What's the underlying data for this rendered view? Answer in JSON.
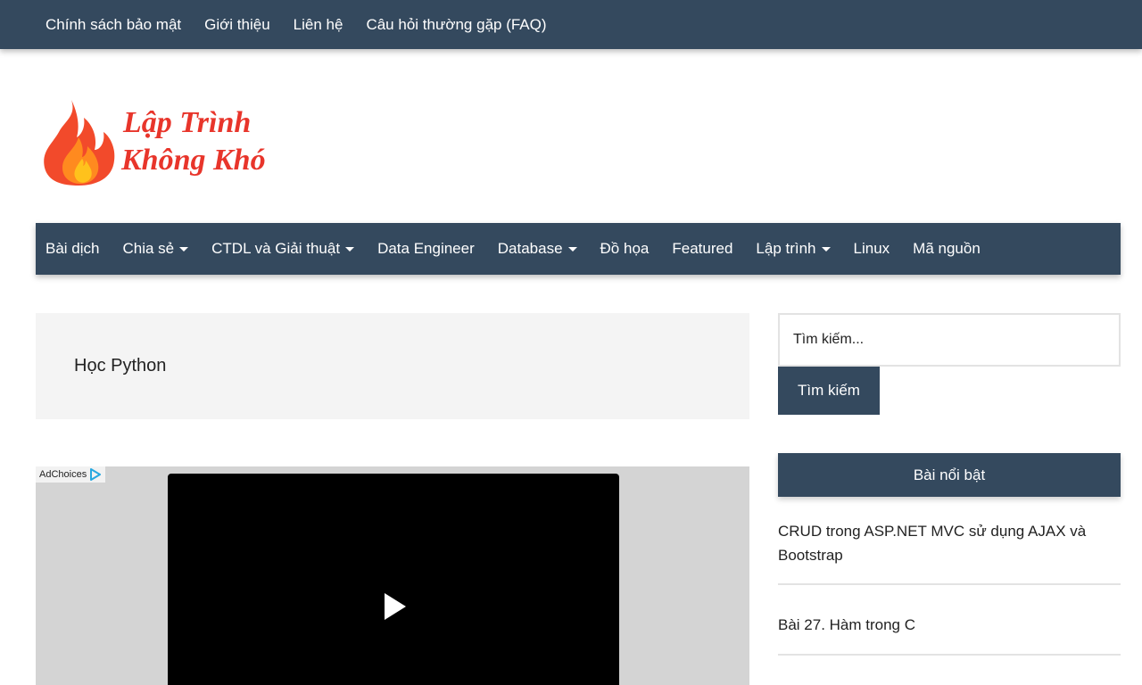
{
  "top_nav": {
    "items": [
      "Chính sách bảo mật",
      "Giới thiệu",
      "Liên hệ",
      "Câu hỏi thường gặp (FAQ)"
    ]
  },
  "logo": {
    "line1": "Lập Trình",
    "line2": "Không Khó",
    "text_color": "#e8352b",
    "flame_colors": [
      "#f24a2b",
      "#ff8a1f",
      "#ffc21c"
    ]
  },
  "main_nav": {
    "items": [
      {
        "label": "Bài dịch",
        "has_dropdown": false
      },
      {
        "label": "Chia sẻ",
        "has_dropdown": true
      },
      {
        "label": "CTDL và Giải thuật",
        "has_dropdown": true
      },
      {
        "label": "Data Engineer",
        "has_dropdown": false
      },
      {
        "label": "Database",
        "has_dropdown": true
      },
      {
        "label": "Đồ họa",
        "has_dropdown": false
      },
      {
        "label": "Featured",
        "has_dropdown": false
      },
      {
        "label": "Lập trình",
        "has_dropdown": true
      },
      {
        "label": "Linux",
        "has_dropdown": false
      },
      {
        "label": "Mã nguồn",
        "has_dropdown": false
      }
    ]
  },
  "page": {
    "title": "Học Python"
  },
  "ad": {
    "label": "AdChoices",
    "icon": "adchoices-icon",
    "video_icon": "play-icon"
  },
  "search": {
    "placeholder": "Tìm kiếm...",
    "button_label": "Tìm kiếm"
  },
  "sidebar": {
    "widget_title": "Bài nổi bật",
    "posts": [
      "CRUD trong ASP.NET MVC sử dụng AJAX và Bootstrap",
      "Bài 27. Hàm trong C"
    ]
  },
  "colors": {
    "nav_background": "#34495e",
    "header_background": "#f4f4f4",
    "ad_background": "#d4d4d4"
  }
}
